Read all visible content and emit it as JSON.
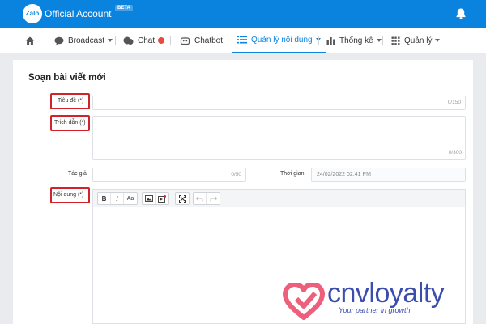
{
  "header": {
    "logo_text": "Zalo",
    "brand": "Official Account",
    "badge": "BETA",
    "icons": {
      "bell": "bell-icon"
    },
    "colors": {
      "bar": "#0a83df"
    }
  },
  "nav": {
    "items": [
      {
        "id": "home",
        "label": "",
        "icon": "home-icon"
      },
      {
        "id": "broadcast",
        "label": "Broadcast",
        "icon": "megaphone-icon",
        "dropdown": true
      },
      {
        "id": "chat",
        "label": "Chat",
        "icon": "chat-bubbles-icon",
        "badge": ""
      },
      {
        "id": "chatbot",
        "label": "Chatbot",
        "icon": "robot-icon"
      },
      {
        "id": "content",
        "label": "Quản lý nội dung",
        "icon": "list-icon",
        "dropdown": true,
        "active": true
      },
      {
        "id": "stats",
        "label": "Thống kê",
        "icon": "bar-chart-icon",
        "dropdown": true
      },
      {
        "id": "manage",
        "label": "Quản lý",
        "icon": "grid-icon",
        "dropdown": true
      }
    ],
    "active_color": "#0a83df"
  },
  "page": {
    "title": "Soạn bài viết mới"
  },
  "form": {
    "title": {
      "label": "Tiêu đề (*)",
      "value": "",
      "counter": "0/150"
    },
    "excerpt": {
      "label": "Trích dẫn (*)",
      "value": "",
      "counter": "0/300"
    },
    "author": {
      "label": "Tác giả",
      "value": "",
      "counter": "0/50"
    },
    "time": {
      "label": "Thời gian",
      "value": "24/02/2022 02:41 PM"
    },
    "content": {
      "label": "Nội dung (*)",
      "toolbar": {
        "bold": "B",
        "italic": "I",
        "font_size": "Aa",
        "image": "image-icon",
        "video": "video-icon",
        "fullscreen": "fullscreen-icon",
        "undo": "undo-icon",
        "redo": "redo-icon"
      }
    },
    "highlight_color": "#d0232a"
  },
  "watermark": {
    "name": "cnvloyalty",
    "tagline": "Your partner in growth",
    "colors": {
      "heart": "#ee5f7b",
      "text": "#3b4dad"
    }
  }
}
